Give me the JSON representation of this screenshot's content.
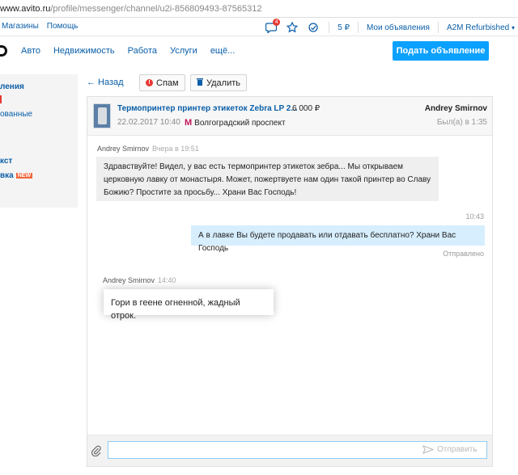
{
  "browser": {
    "url_host": "www.avito.ru",
    "url_path": "/profile/messenger/channel/u2i-856809493-87565312"
  },
  "topbar": {
    "stores": "Магазины",
    "help": "Помощь",
    "notifications_count": "4",
    "wallet": "5 ₽",
    "my_ads": "Мои объявления",
    "account": "A2M Refurbished"
  },
  "nav": {
    "items": [
      "Авто",
      "Недвижимость",
      "Работа",
      "Услуги",
      "ещё..."
    ],
    "post_button": "Подать объявление"
  },
  "sidebar": {
    "items": [
      "ления",
      "",
      "ованные",
      "кст",
      "вка"
    ],
    "new_badge": "NEW"
  },
  "toolbar": {
    "back": "← Назад",
    "spam": "Спам",
    "delete": "Удалить"
  },
  "listing": {
    "title": "Термопринтер принтер этикеток Zebra LP 2...",
    "price": "6 000 ₽",
    "date": "22.02.2017 10:40",
    "metro_station": "Волгоградский проспект",
    "user_name": "Andrey Smirnov",
    "last_seen": "Был(а) в 1:35"
  },
  "messages": [
    {
      "author": "Andrey Smirnov",
      "time": "Вчера в 19:51",
      "text": "Здравствуйте! Видел, у вас есть термопринтер этикеток зебра... Мы открываем церковную лавку от монастыря. Может, пожертвуете нам один такой принтер во Славу Божию? Простите за просьбу... Храни Вас Господь!"
    },
    {
      "time": "10:43",
      "text": "А в лавке Вы будете продавать или отдавать бесплатно? Храни Вас Господь",
      "status": "Отправлено"
    },
    {
      "author": "Andrey Smirnov",
      "time": "14:40",
      "text": "Гори в геене огненной, жадный отрок."
    }
  ],
  "compose": {
    "placeholder": "",
    "send_label": "Отправить"
  },
  "colors": {
    "link": "#0a5ea8",
    "accent_button": "#0aa1ff",
    "outgoing_bubble": "#d7eefe",
    "incoming_bubble": "#efefef",
    "new_badge": "#f2663a",
    "metro": "#c2185b"
  }
}
